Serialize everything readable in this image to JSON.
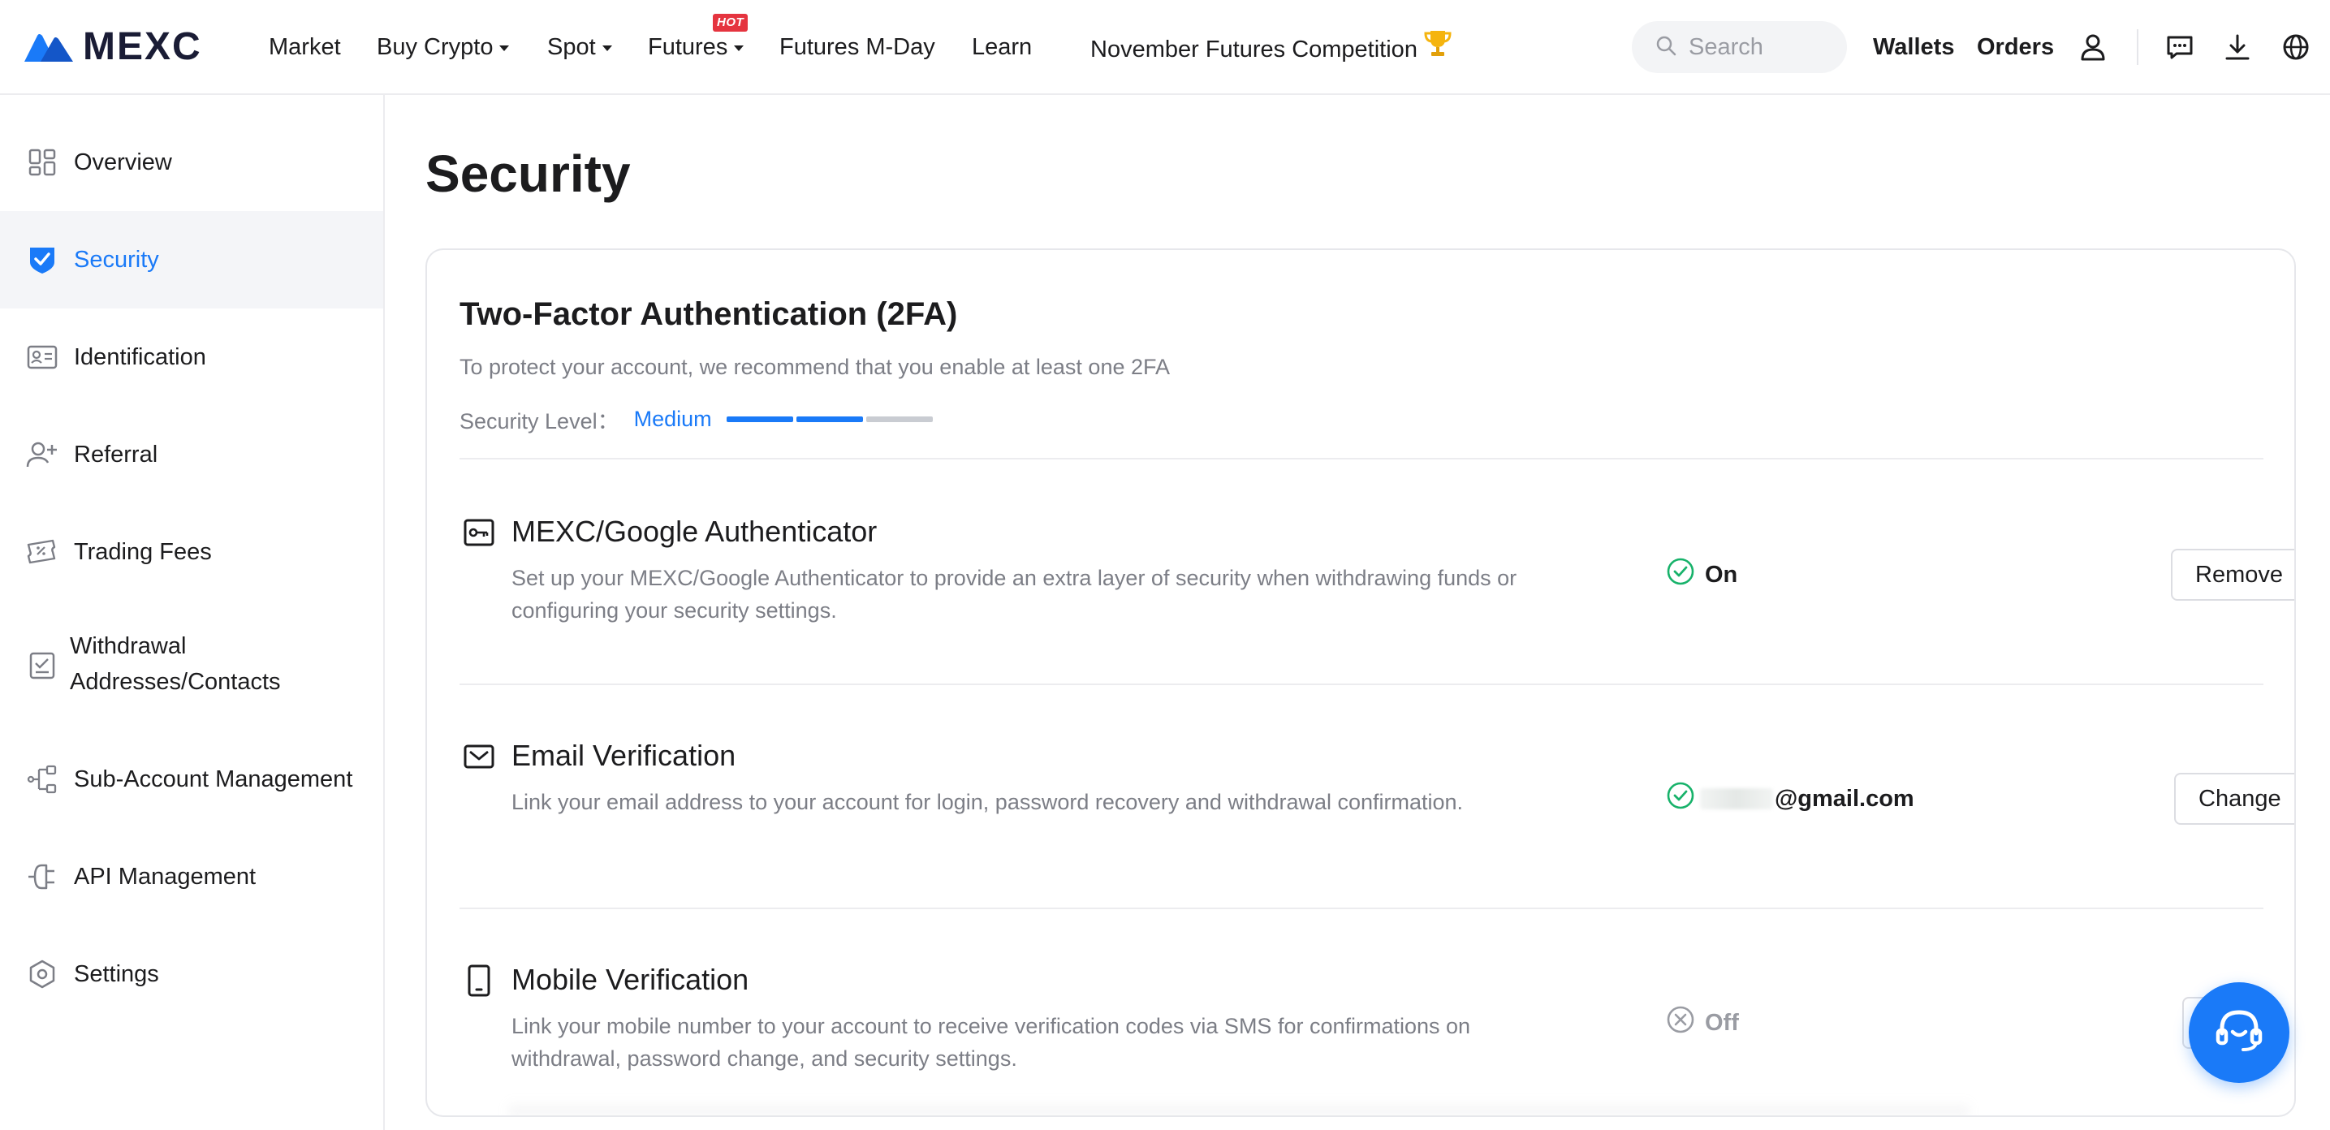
{
  "nav": {
    "brand": "MEXC",
    "items": [
      {
        "label": "Market"
      },
      {
        "label": "Buy Crypto"
      },
      {
        "label": "Spot"
      },
      {
        "label": "Futures"
      },
      {
        "label": "Futures M-Day"
      },
      {
        "label": "Learn"
      },
      {
        "label": "November Futures Competition"
      }
    ],
    "hot_badge": "HOT",
    "search_placeholder": "Search",
    "wallets": "Wallets",
    "orders": "Orders"
  },
  "sidebar": {
    "items": [
      {
        "label": "Overview",
        "icon": "grid-icon"
      },
      {
        "label": "Security",
        "icon": "shield-icon"
      },
      {
        "label": "Identification",
        "icon": "id-card-icon"
      },
      {
        "label": "Referral",
        "icon": "user-plus-icon"
      },
      {
        "label": "Trading Fees",
        "icon": "ticket-icon"
      },
      {
        "label": "Withdrawal",
        "label2": "Addresses/Contacts",
        "icon": "checklist-icon"
      },
      {
        "label": "Sub-Account Management",
        "icon": "hierarchy-icon"
      },
      {
        "label": "API Management",
        "icon": "plug-icon"
      },
      {
        "label": "Settings",
        "icon": "hexagon-gear-icon"
      }
    ]
  },
  "page": {
    "title": "Security"
  },
  "twofa": {
    "title": "Two-Factor Authentication (2FA)",
    "subtitle": "To protect your account, we recommend that you enable at least one 2FA",
    "level_label": "Security Level：",
    "level_value": "Medium",
    "level_segments_filled": 2,
    "level_segments_total": 3
  },
  "methods": [
    {
      "title": "MEXC/Google Authenticator",
      "description": "Set up your MEXC/Google Authenticator to provide an extra layer of security when withdrawing funds or configuring your security settings.",
      "status": "On",
      "action": "Remove",
      "icon": "key-icon"
    },
    {
      "title": "Email Verification",
      "description": "Link your email address to your account for login, password recovery and withdrawal confirmation.",
      "status_prefix": "",
      "status": "@gmail.com",
      "action": "Change",
      "icon": "mail-icon"
    },
    {
      "title": "Mobile Verification",
      "description": "Link your mobile number to your account to receive verification codes via SMS for confirmations on withdrawal, password change, and security settings.",
      "status": "Off",
      "action": "Se",
      "icon": "mobile-icon"
    }
  ],
  "colors": {
    "accent": "#1a7af8",
    "success": "#17b26a",
    "muted": "#9a9ca3",
    "level_empty": "#c9ccd2"
  }
}
